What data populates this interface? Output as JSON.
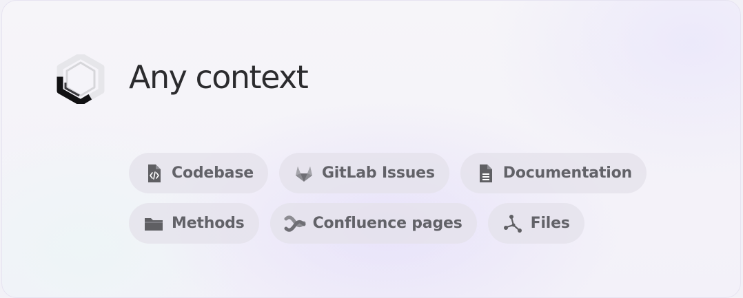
{
  "header": {
    "logo_icon": "hexagon-logo-icon",
    "title": "Any context"
  },
  "chips": {
    "row1": [
      {
        "label": "Codebase",
        "icon": "code-file-icon"
      },
      {
        "label": "GitLab Issues",
        "icon": "gitlab-icon"
      },
      {
        "label": "Documentation",
        "icon": "document-icon"
      }
    ],
    "row2": [
      {
        "label": "Methods",
        "icon": "folder-icon"
      },
      {
        "label": "Confluence pages",
        "icon": "confluence-icon"
      },
      {
        "label": "Files",
        "icon": "graph-nodes-icon"
      }
    ]
  },
  "colors": {
    "title_text": "#2b2b2e",
    "chip_text": "#626268",
    "chip_background": "#e4e2ea",
    "icon_fill": "#5f5f63",
    "card_background": "#f4f3f9"
  }
}
